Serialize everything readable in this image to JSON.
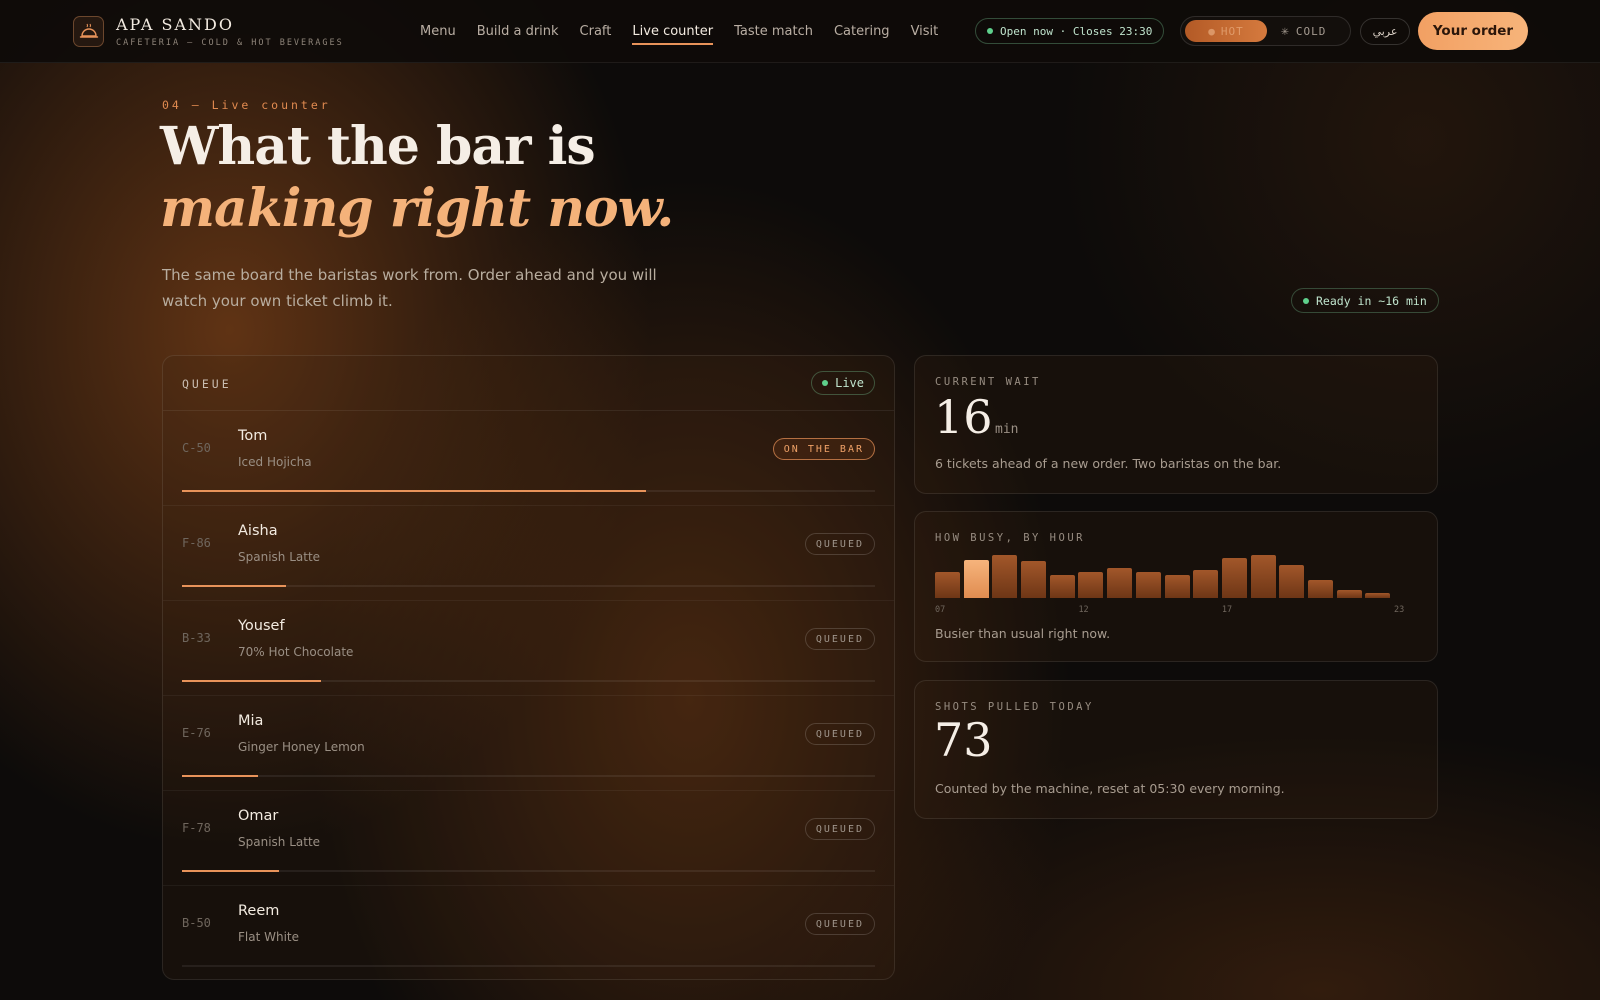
{
  "header": {
    "brand_name": "APA SANDO",
    "brand_tagline": "CAFETERIA — COLD & HOT BEVERAGES",
    "nav": [
      {
        "label": "Menu",
        "active": false
      },
      {
        "label": "Build a drink",
        "active": false
      },
      {
        "label": "Craft",
        "active": false
      },
      {
        "label": "Live counter",
        "active": true
      },
      {
        "label": "Taste match",
        "active": false
      },
      {
        "label": "Catering",
        "active": false
      },
      {
        "label": "Visit",
        "active": false
      }
    ],
    "open_status": "Open now · Closes 23:30",
    "toggle_hot": "HOT",
    "toggle_cold": "COLD",
    "toggle_cold_icon": "snowflake-icon",
    "language": "عربي",
    "order_button": "Your order"
  },
  "hero": {
    "eyebrow": "04 — Live counter",
    "title_plain": "What the bar is ",
    "title_accent": "making right now.",
    "subtitle": "The same board the baristas work from. Order ahead and you will watch your own ticket climb it.",
    "ready_badge": "Ready in ~16 min"
  },
  "queue": {
    "title": "QUEUE",
    "live_label": "Live",
    "tickets": [
      {
        "code": "C-50",
        "name": "Tom",
        "drink": "Iced Hojicha",
        "status": "ON THE BAR",
        "progress": 0.67
      },
      {
        "code": "F-86",
        "name": "Aisha",
        "drink": "Spanish Latte",
        "status": "QUEUED",
        "progress": 0.15
      },
      {
        "code": "B-33",
        "name": "Yousef",
        "drink": "70% Hot Chocolate",
        "status": "QUEUED",
        "progress": 0.2
      },
      {
        "code": "E-76",
        "name": "Mia",
        "drink": "Ginger Honey Lemon",
        "status": "QUEUED",
        "progress": 0.11
      },
      {
        "code": "F-78",
        "name": "Omar",
        "drink": "Spanish Latte",
        "status": "QUEUED",
        "progress": 0.14
      },
      {
        "code": "B-50",
        "name": "Reem",
        "drink": "Flat White",
        "status": "QUEUED",
        "progress": 0
      }
    ]
  },
  "stats": {
    "current_wait": {
      "label": "CURRENT WAIT",
      "value": "16",
      "unit": "min",
      "note": "6 tickets ahead of a new order. Two baristas on the bar."
    },
    "busy": {
      "label": "HOW BUSY, BY HOUR",
      "note": "Busier than usual right now."
    },
    "shots": {
      "label": "SHOTS PULLED TODAY",
      "value": "73",
      "note": "Counted by the machine, reset at 05:30 every morning."
    }
  },
  "chart_data": {
    "type": "bar",
    "categories": [
      "07",
      "08",
      "09",
      "10",
      "11",
      "12",
      "13",
      "14",
      "15",
      "16",
      "17",
      "18",
      "19",
      "20",
      "21",
      "22",
      "23"
    ],
    "values": [
      26,
      38,
      43,
      37,
      23,
      26,
      30,
      26,
      23,
      28,
      40,
      43,
      33,
      18,
      8,
      5,
      0
    ],
    "highlight_index": 1,
    "tick_labels": [
      "07",
      "12",
      "17",
      "23"
    ],
    "ylim": [
      0,
      44
    ],
    "colors": {
      "bar": "#8a4520",
      "highlight": "#f0a064"
    }
  },
  "colors": {
    "accent": "#e8935a",
    "live_green": "#5fd08c",
    "order_button": "#f2a063"
  }
}
